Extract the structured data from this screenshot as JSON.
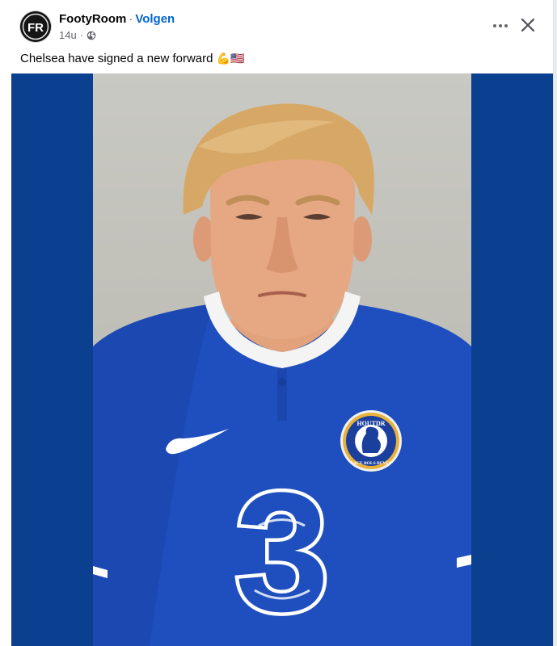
{
  "post": {
    "author": "FootyRoom",
    "separator": "·",
    "follow_label": "Volgen",
    "time": "14u",
    "time_separator": "·",
    "audience_icon": "globe-icon",
    "caption": "Chelsea have signed a new forward",
    "caption_emojis": "💪🇺🇸",
    "avatar_logo": "FR"
  },
  "actions": {
    "more_icon": "more-options-icon",
    "close_icon": "close-icon"
  },
  "image": {
    "badge_text_top": "HOUTDR",
    "badge_text_bottom": "SACE BOLS BEVES",
    "sponsor": "3"
  },
  "colors": {
    "link_blue": "#0064d1",
    "media_background": "#0b3f8f",
    "shirt_blue": "#1f4fbf",
    "text_primary": "#050505",
    "text_secondary": "#65676b"
  }
}
